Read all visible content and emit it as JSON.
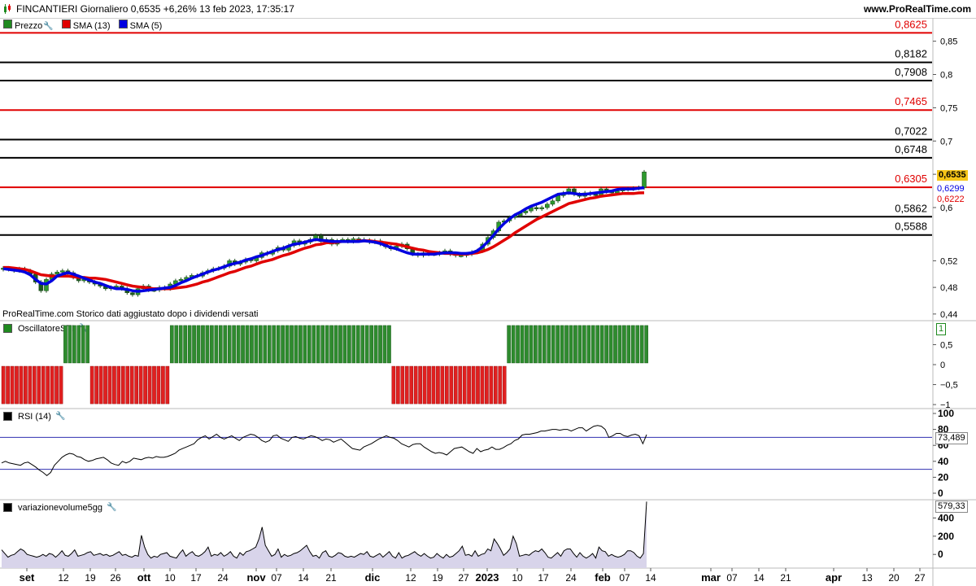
{
  "header": {
    "title": "FINCANTIERI Giornaliero 0,6535 +6,26% 13 feb 2023, 17:35:17",
    "site": "www.ProRealTime.com"
  },
  "price_panel": {
    "legend": [
      {
        "label": "Prezzo",
        "color": "#1f8a1f",
        "icon": "candlestick-icon"
      },
      {
        "label": "SMA (13)",
        "color": "#e00000",
        "icon": "line-icon"
      },
      {
        "label": "SMA (5)",
        "color": "#0000e0",
        "icon": "line-icon"
      }
    ],
    "watermark": "ProRealTime.com  Storico dati aggiustato dopo i dividendi versati",
    "last_price_label": "0,6535",
    "sma5_label": "0,6299",
    "sma13_label": "0,6222",
    "colors": {
      "up": "#1f8a1f",
      "down": "#1f6a1f",
      "sma13": "#e00000",
      "sma5": "#0000e0",
      "last": "#f5c518"
    }
  },
  "oscillator_panel": {
    "legend": "OscillatoreSTI",
    "value_tag": "1"
  },
  "rsi_panel": {
    "legend": "RSI (14)",
    "value_tag": "73,489"
  },
  "volume_panel": {
    "legend": "variazionevolume5gg",
    "value_tag": "579,33"
  },
  "x_axis": {
    "labels": [
      "set",
      "12",
      "19",
      "26",
      "ott",
      "10",
      "17",
      "24",
      "nov",
      "07",
      "14",
      "21",
      "dic",
      "12",
      "19",
      "27",
      "2023",
      "10",
      "17",
      "24",
      "feb",
      "07",
      "14",
      "mar",
      "07",
      "14",
      "21",
      "apr",
      "13",
      "20",
      "27"
    ]
  },
  "chart_data": [
    {
      "type": "candlestick",
      "title": "FINCANTIERI Giornaliero",
      "ylim": [
        0.43,
        0.885
      ],
      "y_ticks": [
        "0,44",
        "0,48",
        "0,52",
        "0,6",
        "0,65",
        "0,7",
        "0,75",
        "0,8",
        "0,85"
      ],
      "horizontal_levels": [
        {
          "value": 0.8625,
          "label": "0,8625",
          "color": "#e00000"
        },
        {
          "value": 0.8182,
          "label": "0,8182",
          "color": "#000000"
        },
        {
          "value": 0.7908,
          "label": "0,7908",
          "color": "#000000"
        },
        {
          "value": 0.7465,
          "label": "0,7465",
          "color": "#e00000"
        },
        {
          "value": 0.7022,
          "label": "0,7022",
          "color": "#000000"
        },
        {
          "value": 0.6748,
          "label": "0,6748",
          "color": "#000000"
        },
        {
          "value": 0.6305,
          "label": "0,6305",
          "color": "#e00000"
        },
        {
          "value": 0.5862,
          "label": "0,5862",
          "color": "#000000"
        },
        {
          "value": 0.5588,
          "label": "0,5588",
          "color": "#000000"
        }
      ],
      "close": [
        0.509,
        0.507,
        0.505,
        0.508,
        0.505,
        0.5,
        0.488,
        0.475,
        0.492,
        0.5,
        0.503,
        0.505,
        0.502,
        0.495,
        0.49,
        0.492,
        0.488,
        0.485,
        0.482,
        0.478,
        0.48,
        0.482,
        0.478,
        0.472,
        0.469,
        0.478,
        0.482,
        0.476,
        0.476,
        0.48,
        0.478,
        0.485,
        0.49,
        0.492,
        0.495,
        0.498,
        0.497,
        0.502,
        0.505,
        0.508,
        0.509,
        0.512,
        0.52,
        0.515,
        0.518,
        0.522,
        0.52,
        0.525,
        0.532,
        0.53,
        0.535,
        0.54,
        0.536,
        0.543,
        0.55,
        0.545,
        0.548,
        0.552,
        0.558,
        0.549,
        0.552,
        0.545,
        0.55,
        0.552,
        0.549,
        0.553,
        0.552,
        0.551,
        0.548,
        0.55,
        0.545,
        0.541,
        0.538,
        0.542,
        0.545,
        0.538,
        0.53,
        0.528,
        0.532,
        0.53,
        0.53,
        0.532,
        0.535,
        0.53,
        0.528,
        0.528,
        0.53,
        0.533,
        0.535,
        0.545,
        0.555,
        0.565,
        0.578,
        0.58,
        0.585,
        0.588,
        0.592,
        0.595,
        0.6,
        0.598,
        0.6,
        0.605,
        0.61,
        0.618,
        0.622,
        0.628,
        0.62,
        0.617,
        0.622,
        0.62,
        0.618,
        0.628,
        0.624,
        0.622,
        0.625,
        0.627,
        0.628,
        0.629,
        0.63,
        0.6535
      ],
      "sma13": [
        0.51,
        0.51,
        0.509,
        0.508,
        0.507,
        0.505,
        0.502,
        0.499,
        0.498,
        0.497,
        0.497,
        0.497,
        0.497,
        0.496,
        0.495,
        0.495,
        0.494,
        0.494,
        0.493,
        0.492,
        0.49,
        0.488,
        0.486,
        0.484,
        0.482,
        0.481,
        0.48,
        0.479,
        0.478,
        0.478,
        0.478,
        0.478,
        0.479,
        0.48,
        0.481,
        0.483,
        0.485,
        0.488,
        0.49,
        0.493,
        0.496,
        0.499,
        0.502,
        0.504,
        0.507,
        0.51,
        0.512,
        0.515,
        0.518,
        0.52,
        0.522,
        0.525,
        0.528,
        0.53,
        0.533,
        0.536,
        0.539,
        0.541,
        0.544,
        0.545,
        0.547,
        0.547,
        0.548,
        0.549,
        0.549,
        0.549,
        0.55,
        0.55,
        0.55,
        0.549,
        0.548,
        0.547,
        0.546,
        0.545,
        0.543,
        0.541,
        0.539,
        0.537,
        0.536,
        0.534,
        0.533,
        0.532,
        0.531,
        0.531,
        0.53,
        0.53,
        0.53,
        0.531,
        0.532,
        0.534,
        0.537,
        0.541,
        0.546,
        0.551,
        0.556,
        0.562,
        0.567,
        0.572,
        0.577,
        0.582,
        0.586,
        0.59,
        0.594,
        0.598,
        0.602,
        0.606,
        0.608,
        0.61,
        0.612,
        0.614,
        0.615,
        0.617,
        0.618,
        0.619,
        0.62,
        0.621,
        0.621,
        0.621,
        0.622,
        0.6222
      ],
      "sma5": [
        0.508,
        0.507,
        0.506,
        0.505,
        0.503,
        0.499,
        0.492,
        0.486,
        0.485,
        0.49,
        0.497,
        0.5,
        0.502,
        0.5,
        0.497,
        0.494,
        0.491,
        0.488,
        0.486,
        0.483,
        0.48,
        0.478,
        0.478,
        0.477,
        0.475,
        0.474,
        0.475,
        0.476,
        0.477,
        0.478,
        0.479,
        0.48,
        0.483,
        0.487,
        0.49,
        0.494,
        0.497,
        0.5,
        0.503,
        0.506,
        0.508,
        0.511,
        0.514,
        0.516,
        0.518,
        0.521,
        0.523,
        0.526,
        0.528,
        0.531,
        0.534,
        0.537,
        0.539,
        0.542,
        0.545,
        0.546,
        0.548,
        0.55,
        0.552,
        0.551,
        0.55,
        0.549,
        0.549,
        0.549,
        0.549,
        0.549,
        0.549,
        0.55,
        0.549,
        0.548,
        0.546,
        0.543,
        0.54,
        0.538,
        0.535,
        0.532,
        0.53,
        0.53,
        0.53,
        0.53,
        0.53,
        0.531,
        0.532,
        0.532,
        0.532,
        0.531,
        0.531,
        0.532,
        0.535,
        0.541,
        0.549,
        0.558,
        0.568,
        0.576,
        0.583,
        0.589,
        0.593,
        0.598,
        0.602,
        0.605,
        0.608,
        0.612,
        0.616,
        0.62,
        0.621,
        0.622,
        0.621,
        0.62,
        0.62,
        0.621,
        0.622,
        0.623,
        0.624,
        0.625,
        0.627,
        0.628,
        0.628,
        0.628,
        0.629,
        0.6299
      ]
    },
    {
      "type": "bar",
      "title": "OscillatoreSTI",
      "ylim": [
        -1.1,
        1.1
      ],
      "y_ticks": [
        "0,5",
        "0",
        "-0,5",
        "-1"
      ],
      "values": [
        -1,
        -1,
        -1,
        -1,
        -1,
        -1,
        -1,
        -1,
        -1,
        -1,
        -1,
        -1,
        -1,
        -1,
        1,
        1,
        1,
        1,
        1,
        1,
        -1,
        -1,
        -1,
        -1,
        -1,
        -1,
        -1,
        -1,
        -1,
        -1,
        -1,
        -1,
        -1,
        -1,
        -1,
        -1,
        -1,
        -1,
        1,
        1,
        1,
        1,
        1,
        1,
        1,
        1,
        1,
        1,
        1,
        1,
        1,
        1,
        1,
        1,
        1,
        1,
        1,
        1,
        1,
        1,
        1,
        1,
        1,
        1,
        1,
        1,
        1,
        1,
        1,
        1,
        1,
        1,
        1,
        1,
        1,
        1,
        1,
        1,
        1,
        1,
        1,
        1,
        1,
        1,
        1,
        1,
        1,
        1,
        -1,
        -1,
        -1,
        -1,
        -1,
        -1,
        -1,
        -1,
        -1,
        -1,
        -1,
        -1,
        -1,
        -1,
        -1,
        -1,
        -1,
        -1,
        -1,
        -1,
        -1,
        -1,
        -1,
        -1,
        -1,
        -1,
        1,
        1,
        1,
        1,
        1,
        1,
        1,
        1,
        1,
        1,
        1,
        1,
        1,
        1,
        1,
        1,
        1,
        1,
        1,
        1,
        1,
        1,
        1,
        1,
        1,
        1,
        1,
        1,
        1,
        1,
        1,
        1
      ]
    },
    {
      "type": "line",
      "title": "RSI (14)",
      "ylim": [
        0,
        100
      ],
      "y_ticks": [
        "100",
        "80",
        "60",
        "40",
        "20",
        "0"
      ],
      "levels": [
        70,
        30
      ],
      "values": [
        38,
        40,
        38,
        37,
        36,
        35,
        38,
        39,
        36,
        33,
        29,
        26,
        22,
        26,
        35,
        40,
        45,
        48,
        50,
        49,
        46,
        45,
        42,
        40,
        41,
        43,
        44,
        45,
        42,
        38,
        36,
        35,
        40,
        38,
        40,
        44,
        43,
        42,
        44,
        45,
        44,
        46,
        45,
        45,
        46,
        48,
        50,
        54,
        56,
        58,
        60,
        62,
        67,
        70,
        72,
        68,
        71,
        74,
        70,
        68,
        70,
        72,
        69,
        66,
        70,
        72,
        74,
        73,
        70,
        66,
        64,
        66,
        72,
        73,
        69,
        67,
        65,
        70,
        71,
        69,
        68,
        70,
        72,
        71,
        69,
        66,
        68,
        67,
        64,
        66,
        68,
        64,
        60,
        56,
        55,
        54,
        58,
        60,
        62,
        65,
        68,
        70,
        72,
        70,
        69,
        66,
        62,
        60,
        58,
        61,
        62,
        62,
        58,
        55,
        52,
        50,
        51,
        50,
        48,
        52,
        56,
        57,
        58,
        55,
        52,
        50,
        56,
        52,
        54,
        55,
        58,
        55,
        55,
        57,
        60,
        62,
        66,
        68,
        73,
        74,
        74,
        75,
        76,
        78,
        78,
        79,
        80,
        80,
        79,
        80,
        80,
        78,
        80,
        82,
        82,
        78,
        81,
        84,
        85,
        84,
        80,
        70,
        72,
        75,
        75,
        72,
        71,
        73,
        74,
        72,
        62,
        73.489
      ]
    },
    {
      "type": "area",
      "title": "variazionevolume5gg",
      "ylim": [
        -150,
        600
      ],
      "y_ticks": [
        "400",
        "200",
        "0"
      ],
      "values": [
        50,
        10,
        -30,
        -10,
        0,
        30,
        60,
        40,
        0,
        -10,
        -20,
        -30,
        -20,
        0,
        -20,
        10,
        0,
        -30,
        0,
        40,
        -10,
        -20,
        10,
        50,
        -20,
        -10,
        0,
        20,
        30,
        -10,
        0,
        10,
        -10,
        0,
        -20,
        -10,
        10,
        30,
        -10,
        0,
        -20,
        -30,
        -10,
        -20,
        210,
        80,
        0,
        -40,
        -20,
        -30,
        0,
        10,
        20,
        -20,
        -30,
        -40,
        10,
        50,
        -20,
        10,
        30,
        -10,
        -20,
        0,
        30,
        80,
        -20,
        0,
        -10,
        20,
        -20,
        0,
        30,
        -20,
        -40,
        20,
        -10,
        30,
        40,
        60,
        80,
        170,
        300,
        100,
        40,
        -20,
        0,
        60,
        -30,
        0,
        -20,
        -10,
        10,
        20,
        40,
        70,
        100,
        30,
        -20,
        -10,
        -40,
        20,
        40,
        -20,
        -30,
        -10,
        20,
        10,
        -20,
        -30,
        -20,
        -30,
        -10,
        10,
        0,
        30,
        -20,
        -30,
        -10,
        10,
        -30,
        0,
        30,
        -20,
        -40,
        20,
        -40,
        -20,
        -10,
        10,
        30,
        0,
        -20,
        10,
        -20,
        -40,
        -30,
        10,
        -20,
        -40,
        0,
        -30,
        -20,
        10,
        40,
        90,
        -10,
        0,
        -20,
        40,
        -20,
        0,
        10,
        60,
        40,
        170,
        120,
        60,
        -10,
        20,
        60,
        200,
        120,
        -20,
        -10,
        0,
        -10,
        20,
        40,
        30,
        60,
        20,
        -30,
        -40,
        -10,
        20,
        -20,
        40,
        60,
        60,
        10,
        -30,
        20,
        -20,
        -40,
        -20,
        10,
        -40,
        80,
        40,
        30,
        -20,
        0,
        -20,
        -30,
        -20,
        0,
        40,
        40,
        20,
        -20,
        -40,
        10,
        579.33
      ]
    }
  ]
}
